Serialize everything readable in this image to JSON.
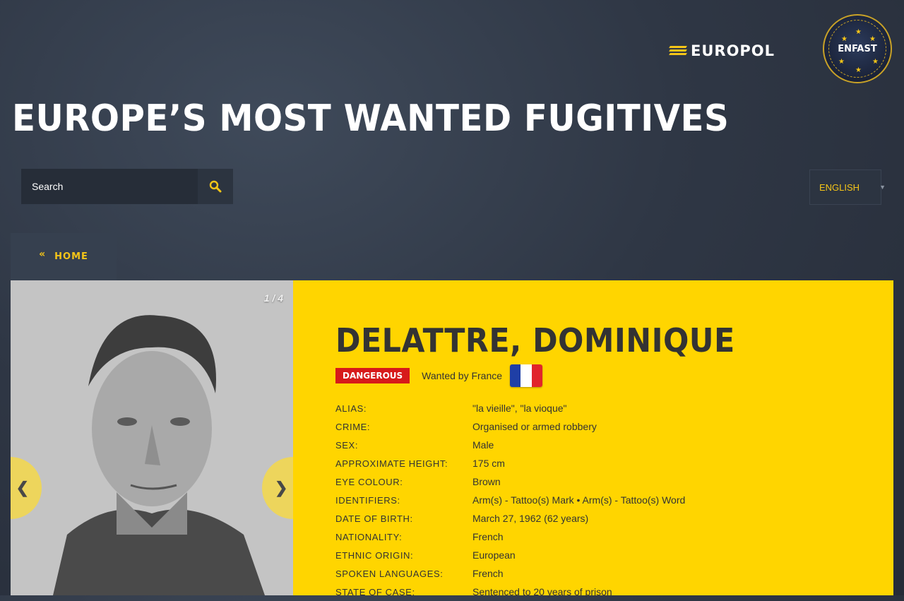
{
  "header": {
    "europol_logo_text": "EUROPOL",
    "enfast_logo_text": "ENFAST",
    "page_title": "EUROPE’S MOST WANTED FUGITIVES"
  },
  "search": {
    "placeholder": "Search"
  },
  "language": {
    "selected": "ENGLISH"
  },
  "nav": {
    "home_label": "HOME"
  },
  "gallery": {
    "counter": "1 / 4",
    "prev": "❮",
    "next": "❯"
  },
  "fugitive": {
    "name": "DELATTRE, DOMINIQUE",
    "badge": "DANGEROUS",
    "wanted_by": "Wanted by France",
    "flag_colors": [
      "#1f3fa6",
      "#ffffff",
      "#e1252b"
    ],
    "details": [
      {
        "label": "ALIAS:",
        "value": "\"la vieille\", \"la vioque\""
      },
      {
        "label": "CRIME:",
        "value": "Organised or armed robbery"
      },
      {
        "label": "SEX:",
        "value": "Male"
      },
      {
        "label": "APPROXIMATE HEIGHT:",
        "value": "175 cm"
      },
      {
        "label": "EYE COLOUR:",
        "value": "Brown"
      },
      {
        "label": "IDENTIFIERS:",
        "value": "Arm(s) - Tattoo(s) Mark • Arm(s) - Tattoo(s) Word"
      },
      {
        "label": "DATE OF BIRTH:",
        "value": "March 27, 1962 (62 years)"
      },
      {
        "label": "NATIONALITY:",
        "value": "French"
      },
      {
        "label": "ETHNIC ORIGIN:",
        "value": "European"
      },
      {
        "label": "SPOKEN LANGUAGES:",
        "value": "French"
      },
      {
        "label": "STATE OF CASE:",
        "value": "Sentenced to 20 years of prison"
      }
    ]
  },
  "colors": {
    "accent": "#ffd500",
    "danger": "#d71a1a",
    "background": "#2f3745"
  }
}
